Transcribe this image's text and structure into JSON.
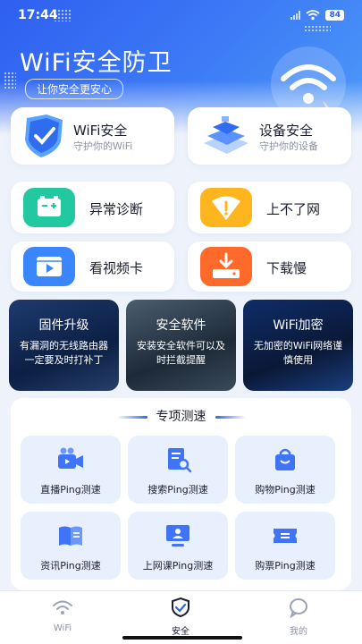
{
  "status_bar": {
    "time": "17:44",
    "battery": "84"
  },
  "header": {
    "title": "WiFi安全防卫",
    "subtitle": "让你安全更安心"
  },
  "top_cards": [
    {
      "title": "WiFi安全",
      "desc": "守护你的WiFi",
      "icon": "shield-check-icon"
    },
    {
      "title": "设备安全",
      "desc": "守护你的设备",
      "icon": "device-stack-icon"
    }
  ],
  "tools": [
    {
      "label": "异常诊断",
      "icon": "battery-diagnose-icon",
      "color": "#22c8a0"
    },
    {
      "label": "上不了网",
      "icon": "wifi-warning-icon",
      "color": "#ffb61e"
    },
    {
      "label": "看视频卡",
      "icon": "video-play-icon",
      "color": "#3a86ff"
    },
    {
      "label": "下载慢",
      "icon": "download-icon",
      "color": "#ff6a2b"
    }
  ],
  "promos": [
    {
      "title": "固件升级",
      "desc": "有漏洞的无线路由器一定要及时打补丁"
    },
    {
      "title": "安全软件",
      "desc": "安装安全软件可以及时拦截提醒"
    },
    {
      "title": "WiFi加密",
      "desc": "无加密的WiFi网络谨慎使用"
    }
  ],
  "speed": {
    "heading": "专项测速",
    "items": [
      {
        "label": "直播Ping测速",
        "icon": "live-camera-icon"
      },
      {
        "label": "搜索Ping测速",
        "icon": "search-doc-icon"
      },
      {
        "label": "购物Ping测速",
        "icon": "shopping-bag-icon"
      },
      {
        "label": "资讯Ping测速",
        "icon": "news-book-icon"
      },
      {
        "label": "上网课Ping测速",
        "icon": "online-class-icon"
      },
      {
        "label": "购票Ping测速",
        "icon": "ticket-icon"
      }
    ]
  },
  "tabs": [
    {
      "label": "WiFi",
      "icon": "wifi-icon",
      "active": false
    },
    {
      "label": "安全",
      "icon": "shield-icon",
      "active": true
    },
    {
      "label": "我的",
      "icon": "chat-bubble-icon",
      "active": false
    }
  ],
  "colors": {
    "primary": "#3062f0",
    "tile_bg": "#e8effd"
  }
}
